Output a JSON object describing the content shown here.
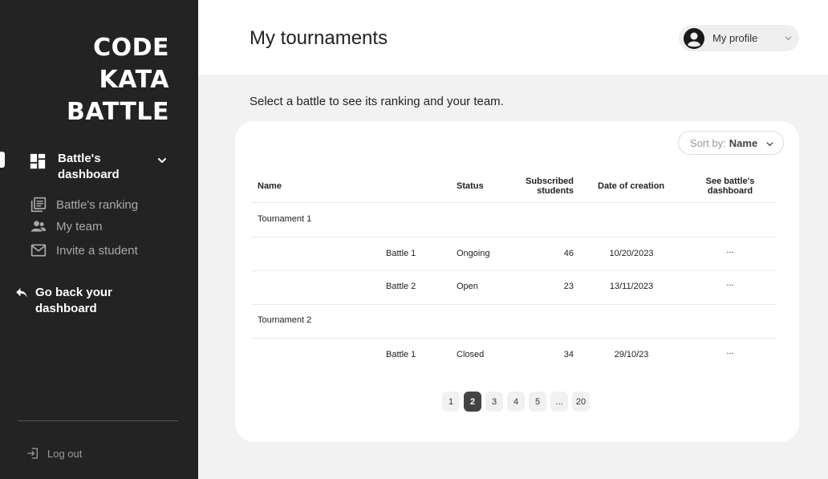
{
  "app": {
    "logo_lines": [
      "CODE",
      "KATA",
      "BATTLE"
    ]
  },
  "sidebar": {
    "dashboard_label": "Battle's dashboard",
    "items": [
      {
        "label": "Battle's ranking",
        "icon": "ranking-icon"
      },
      {
        "label": "My team",
        "icon": "team-icon"
      },
      {
        "label": "Invite a student",
        "icon": "mail-icon"
      }
    ],
    "back_label": "Go back your dashboard",
    "logout_label": "Log out"
  },
  "header": {
    "title": "My tournaments",
    "profile_label": "My profile"
  },
  "main": {
    "subtitle": "Select a battle to see its ranking and your team.",
    "sort_prefix": "Sort by:",
    "sort_value": "Name",
    "columns": {
      "name": "Name",
      "status": "Status",
      "subscribed": "Subscribed students",
      "date": "Date of creation",
      "see": "See battle's dashboard"
    },
    "tournaments": [
      {
        "name": "Tournament 1",
        "battles": [
          {
            "name": "Battle 1",
            "status": "Ongoing",
            "students": "46",
            "date": "10/20/2023",
            "action": "..."
          },
          {
            "name": "Battle 2",
            "status": "Open",
            "students": "23",
            "date": "13/11/2023",
            "action": "..."
          }
        ]
      },
      {
        "name": "Tournament 2",
        "battles": [
          {
            "name": "Battle 1",
            "status": "Closed",
            "students": "34",
            "date": "29/10/23",
            "action": "..."
          }
        ]
      }
    ],
    "pagination": [
      "1",
      "2",
      "3",
      "4",
      "5",
      "...",
      "20"
    ],
    "current_page": "2"
  },
  "colors": {
    "sidebar_bg": "#232323",
    "active_page": "#444444",
    "background": "#f2f2f2"
  }
}
